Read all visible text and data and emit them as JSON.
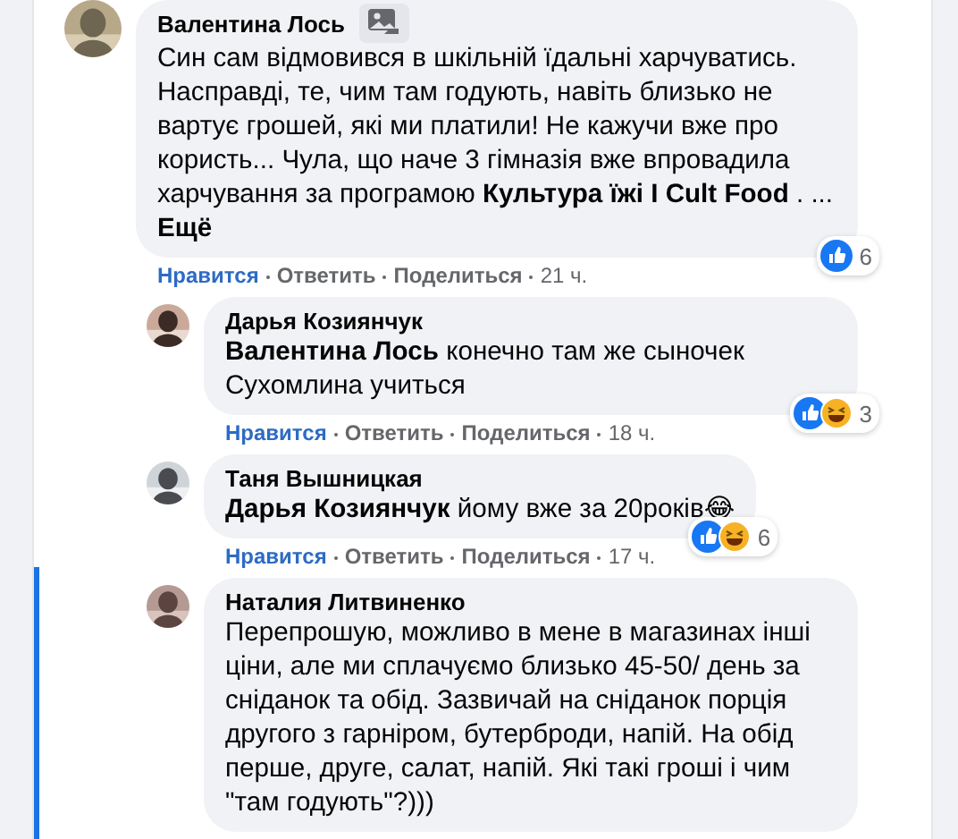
{
  "comments": [
    {
      "author": "Валентина Лось",
      "kind": "top",
      "has_photo_badge": true,
      "highlighted": false,
      "text": "Син сам відмовився в шкільній їдальні харчуватись. Насправді, те, чим там годують, навіть близько не вартує грошей, які ми платили! Не кажучи вже про користь... Чула, що наче 3 гімназія вже впровадила харчування за програмою **Культура їжі I Cult Food** . ...",
      "more": "Ещё",
      "reactions": [
        {
          "kind": "like"
        }
      ],
      "reaction_count": "6",
      "actions": [
        {
          "label": "Нравится",
          "liked": true
        },
        {
          "label": "Ответить",
          "liked": false
        },
        {
          "label": "Поделиться",
          "liked": false
        }
      ],
      "time": "21 ч."
    },
    {
      "author": "Дарья Козиянчук",
      "kind": "reply",
      "has_photo_badge": false,
      "highlighted": false,
      "text": "**Валентина Лось** конечно там же сыночек Сухомлина учиться",
      "reactions": [
        {
          "kind": "like"
        },
        {
          "kind": "haha"
        }
      ],
      "reaction_count": "3",
      "actions": [
        {
          "label": "Нравится",
          "liked": true
        },
        {
          "label": "Ответить",
          "liked": false
        },
        {
          "label": "Поделиться",
          "liked": false
        }
      ],
      "time": "18 ч."
    },
    {
      "author": "Таня Вышницкая",
      "kind": "reply",
      "has_photo_badge": false,
      "highlighted": false,
      "text": "**Дарья Козиянчук** йому вже за 20років😂",
      "reactions": [
        {
          "kind": "like"
        },
        {
          "kind": "haha"
        }
      ],
      "reaction_count": "6",
      "actions": [
        {
          "label": "Нравится",
          "liked": true
        },
        {
          "label": "Ответить",
          "liked": false
        },
        {
          "label": "Поделиться",
          "liked": false
        }
      ],
      "time": "17 ч."
    },
    {
      "author": "Наталия Литвиненко",
      "kind": "reply",
      "has_photo_badge": false,
      "highlighted": true,
      "text": "Перепрошую, можливо в мене в магазинах інші ціни, але ми сплачуємо близько 45-50/ день за сніданок та обід. Зазвичай на сніданок порція другого з гарніром, бутерброди, напій. На обід перше, друге, салат, напій. Які такі гроші і чим \"там годують\"?)))"
    }
  ]
}
